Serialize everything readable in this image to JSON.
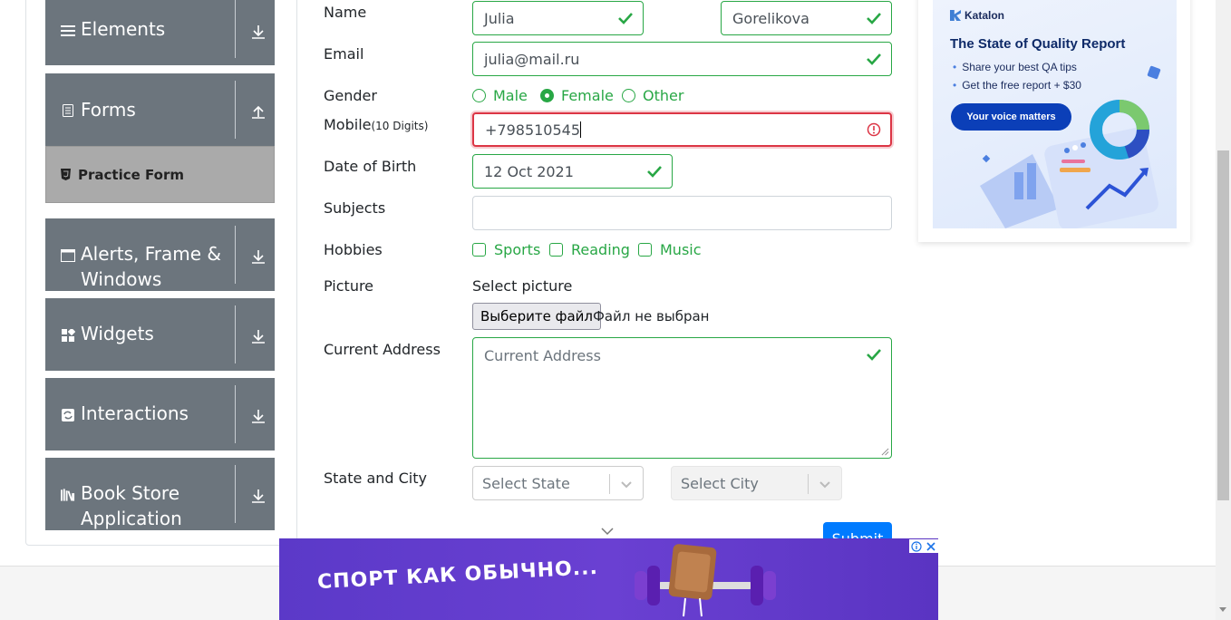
{
  "sidebar": {
    "groups": [
      {
        "title": "Elements",
        "icon": "menu-icon"
      },
      {
        "title": "Forms",
        "icon": "document-icon"
      },
      {
        "title": "Alerts, Frame &",
        "title2": "Windows",
        "icon": "window-icon"
      },
      {
        "title": "Widgets",
        "icon": "widgets-icon"
      },
      {
        "title": "Interactions",
        "icon": "interactions-icon"
      },
      {
        "title": "Book Store",
        "title2": "Application",
        "icon": "books-icon"
      }
    ],
    "active_item": "Practice Form"
  },
  "form": {
    "name_label": "Name",
    "first_name": "Julia",
    "last_name": "Gorelikova",
    "email_label": "Email",
    "email": "julia@mail.ru",
    "gender_label": "Gender",
    "gender_options": [
      "Male",
      "Female",
      "Other"
    ],
    "gender_selected": "Female",
    "mobile_label": "Mobile",
    "mobile_hint": "(10 Digits)",
    "mobile": "+798510545",
    "dob_label": "Date of Birth",
    "dob": "12 Oct 2021",
    "subjects_label": "Subjects",
    "hobbies_label": "Hobbies",
    "hobbies": [
      "Sports",
      "Reading",
      "Music"
    ],
    "picture_label": "Picture",
    "select_picture": "Select picture",
    "file_button": "Выберите файл",
    "file_status": "Файл не выбран",
    "address_label": "Current Address",
    "address_placeholder": "Current Address",
    "state_city_label": "State and City",
    "state_placeholder": "Select State",
    "city_placeholder": "Select City",
    "submit": "Submit"
  },
  "ad": {
    "brand": "Katalon",
    "title": "The State of Quality Report",
    "bullet1": "Share your best QA tips",
    "bullet2": "Get the free report + $30",
    "cta": "Your voice matters"
  },
  "banner": {
    "text": "СПОРТ КАК ОБЫЧНО..."
  },
  "colors": {
    "valid": "#28a745",
    "invalid": "#dc3545",
    "sidebar_bg": "#6c757d",
    "primary": "#007bff"
  }
}
